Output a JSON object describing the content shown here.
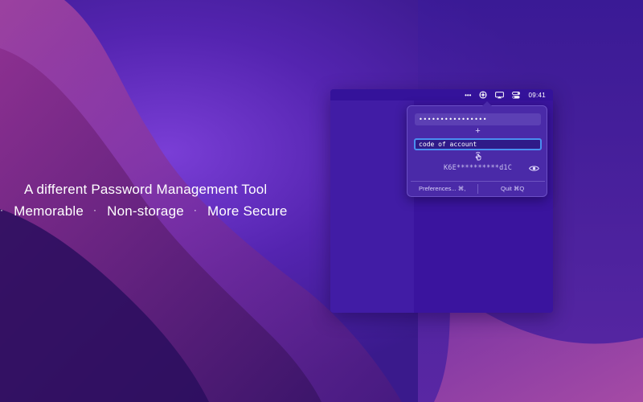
{
  "tagline": {
    "title": "A different Password Management Tool",
    "features": [
      {
        "dot": "·",
        "label": "Memorable"
      },
      {
        "dot": "·",
        "label": "Non-storage"
      },
      {
        "dot": "·",
        "label": "More Secure"
      }
    ]
  },
  "menubar": {
    "items": [
      {
        "label": "•••",
        "icon": "more-dots-icon"
      },
      {
        "icon": "app-status-icon"
      },
      {
        "icon": "screen-mirroring-icon"
      },
      {
        "icon": "control-center-icon"
      }
    ],
    "time": "09:41"
  },
  "popover": {
    "master_password_value": "••••••••••••••••",
    "plus_symbol": "+",
    "code_field_value": "code of account",
    "result_masked": "K6E**********d1C",
    "preferences_label": "Preferences...  ⌘,",
    "quit_label": "Quit  ⌘Q"
  },
  "colors": {
    "accent_focus": "#4a8ef0",
    "popover_bg": "#4a2aa8",
    "wallpaper_primary": "#3a1a8c"
  }
}
